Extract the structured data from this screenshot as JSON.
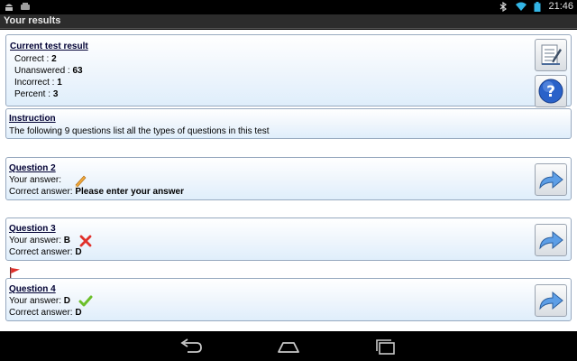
{
  "status_bar": {
    "time": "21:46",
    "icons": [
      "android-debug-icon",
      "usb-icon",
      "bluetooth-icon",
      "wifi-icon",
      "battery-icon"
    ]
  },
  "title": "Your results",
  "result": {
    "title": "Current test result",
    "correct_label": "Correct :",
    "correct": "2",
    "unanswered_label": "Unanswered :",
    "unanswered": "63",
    "incorrect_label": "Incorrect :",
    "incorrect": "1",
    "percent_label": "Percent :",
    "percent": "3"
  },
  "instruction": {
    "title": "Instruction",
    "text": "The following 9 questions list all the types of questions in this test"
  },
  "questions": [
    {
      "title": "Question 2",
      "your_answer_label": "Your answer:",
      "your_answer": "",
      "correct_label": "Correct  answer:",
      "correct_answer": "Please enter your answer",
      "status": "pencil-icon"
    },
    {
      "title": "Question 3",
      "your_answer_label": "Your answer:",
      "your_answer": "B",
      "correct_label": "Correct  answer:",
      "correct_answer": "D",
      "status": "wrong-x-icon"
    },
    {
      "title": "Question 4",
      "your_answer_label": "Your answer:",
      "your_answer": "D",
      "correct_label": "Correct  answer:",
      "correct_answer": "D",
      "status": "correct-check-icon"
    }
  ],
  "colors": {
    "panel_border": "#97a9bf",
    "title_text": "#000033",
    "wrong": "#e0302a",
    "right": "#6cbf2a",
    "help_blue": "#2a62c9"
  }
}
